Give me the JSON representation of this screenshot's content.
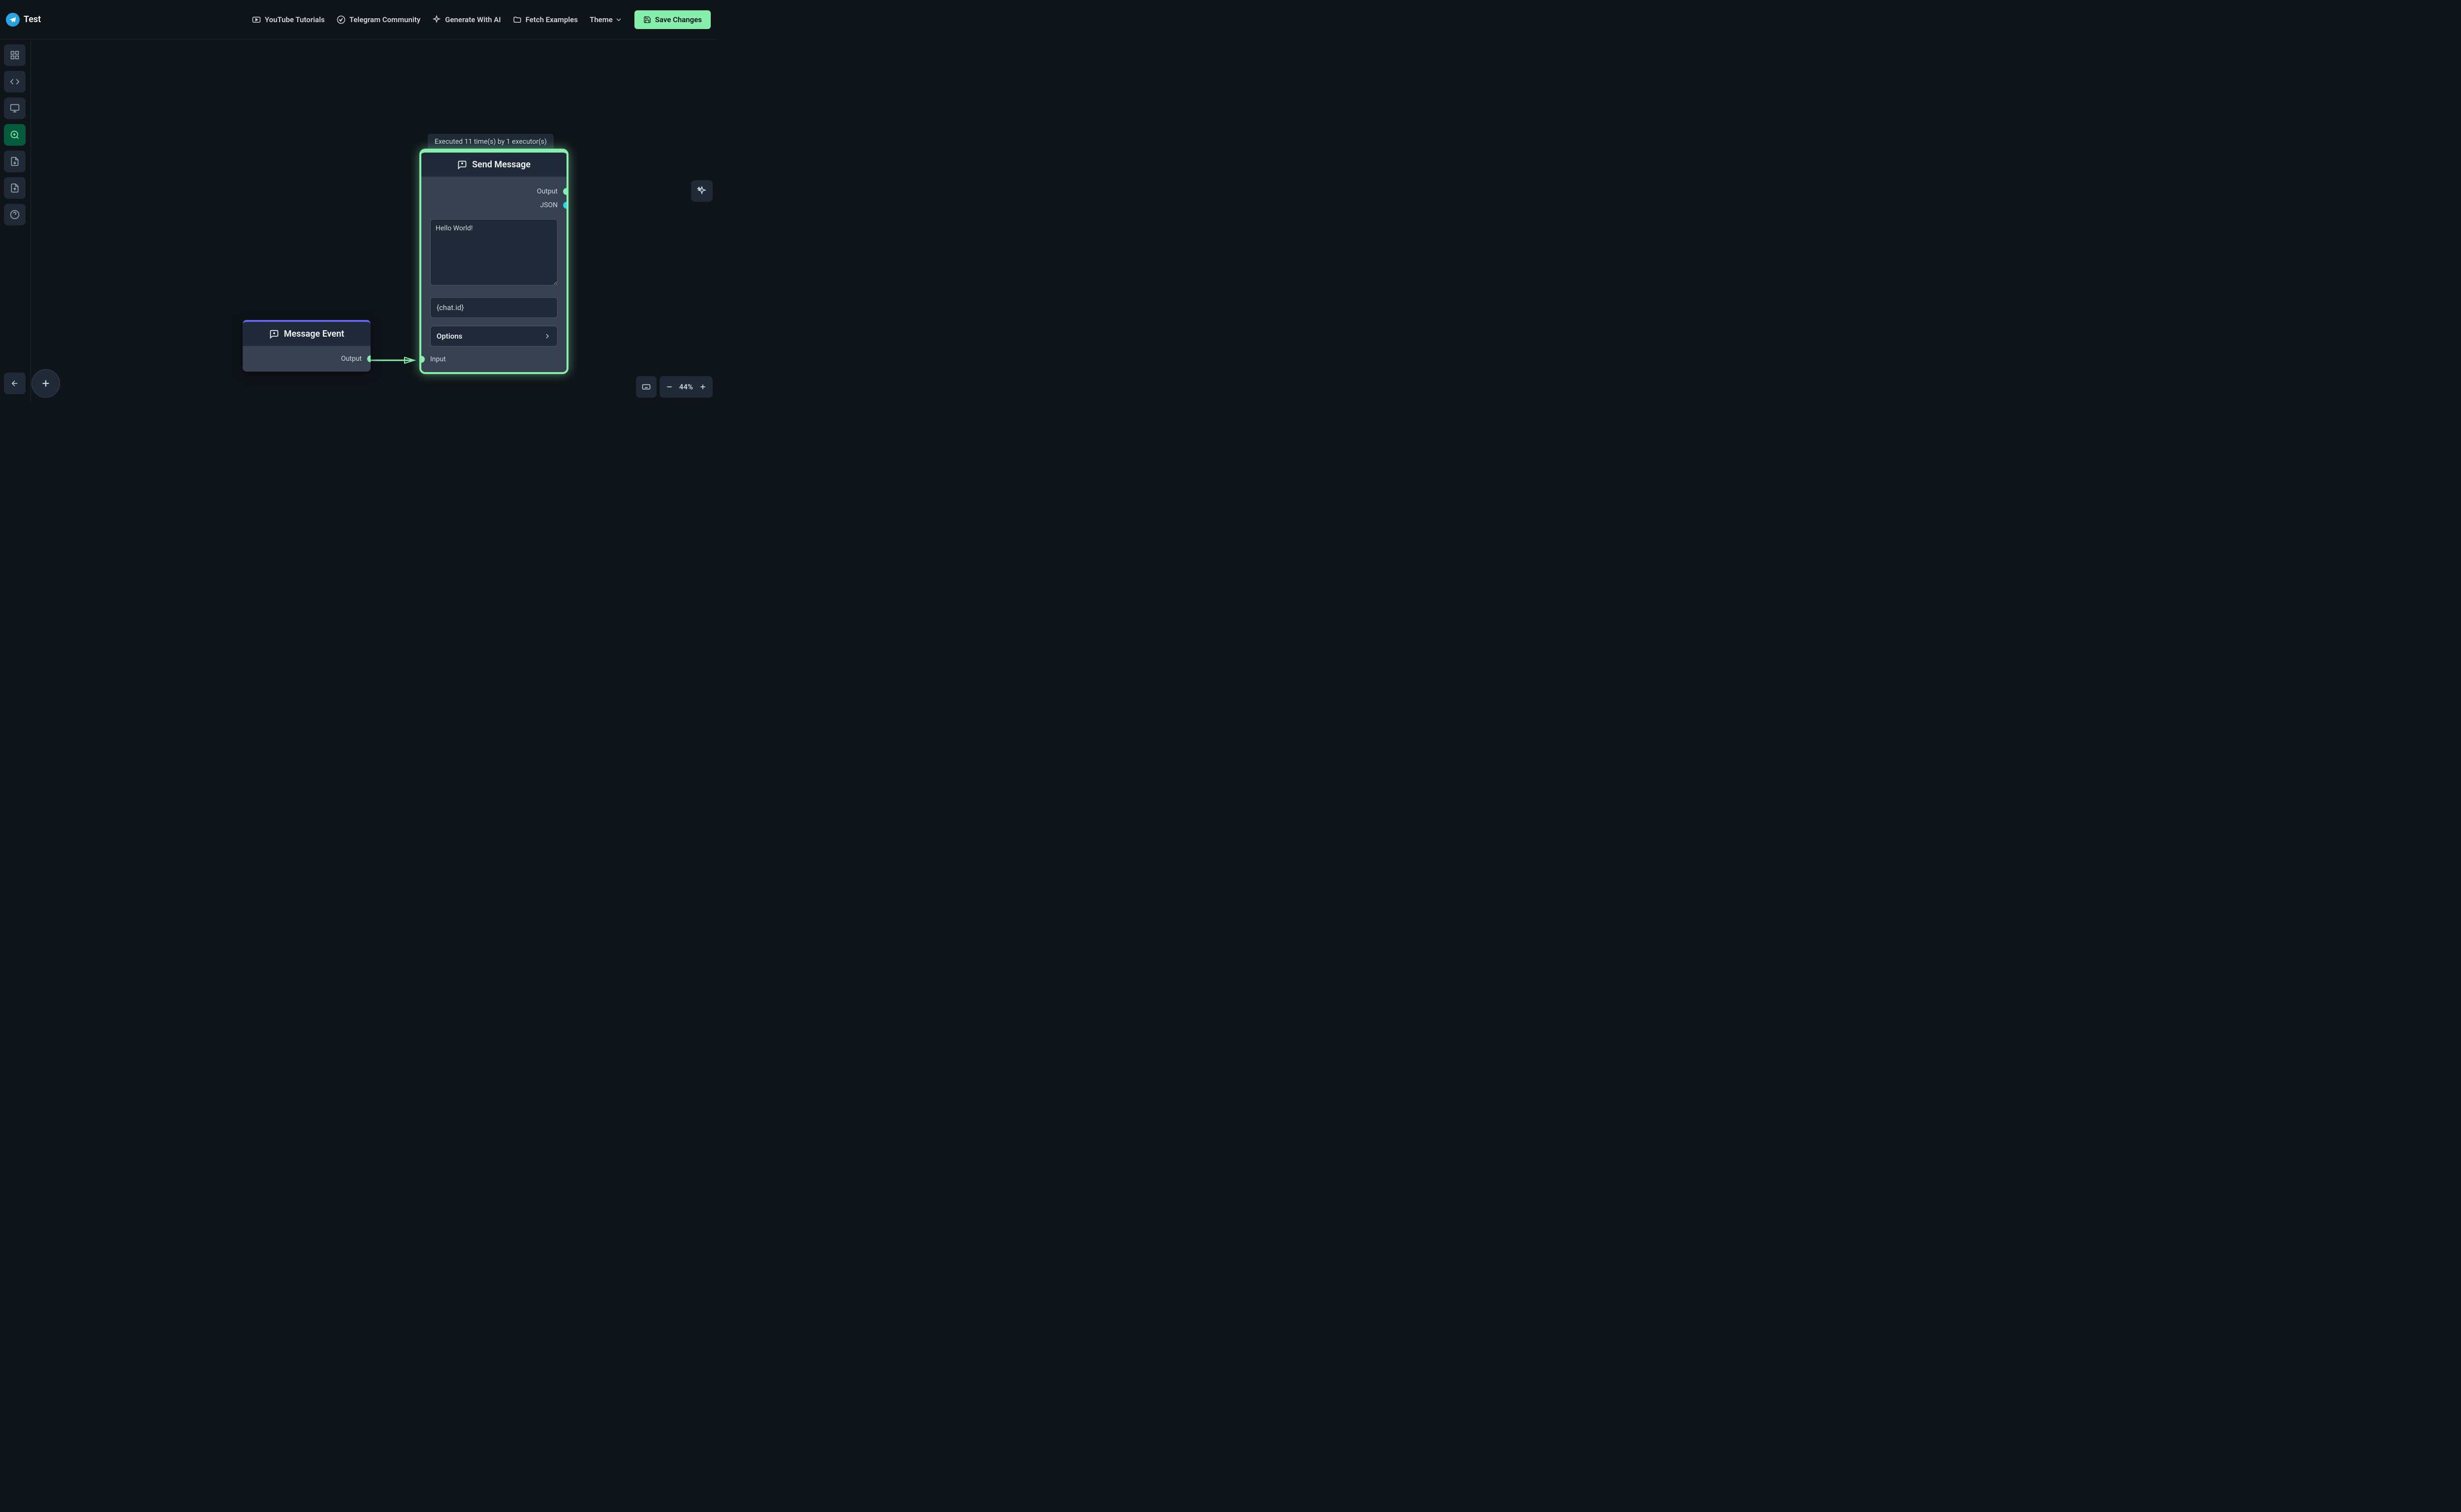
{
  "header": {
    "title": "Test",
    "nav": {
      "youtube": "YouTube Tutorials",
      "telegram": "Telegram Community",
      "generate_ai": "Generate With AI",
      "fetch_examples": "Fetch Examples",
      "theme": "Theme",
      "save": "Save Changes"
    }
  },
  "tooltip": "Executed 11 time(s) by 1 executor(s)",
  "nodes": {
    "message_event": {
      "title": "Message Event",
      "output_label": "Output"
    },
    "send_message": {
      "title": "Send Message",
      "output_label": "Output",
      "json_label": "JSON",
      "text_value": "Hello World!",
      "chat_id_value": "{chat.id}",
      "options_label": "Options",
      "input_label": "Input"
    }
  },
  "zoom": {
    "value": "44%"
  }
}
